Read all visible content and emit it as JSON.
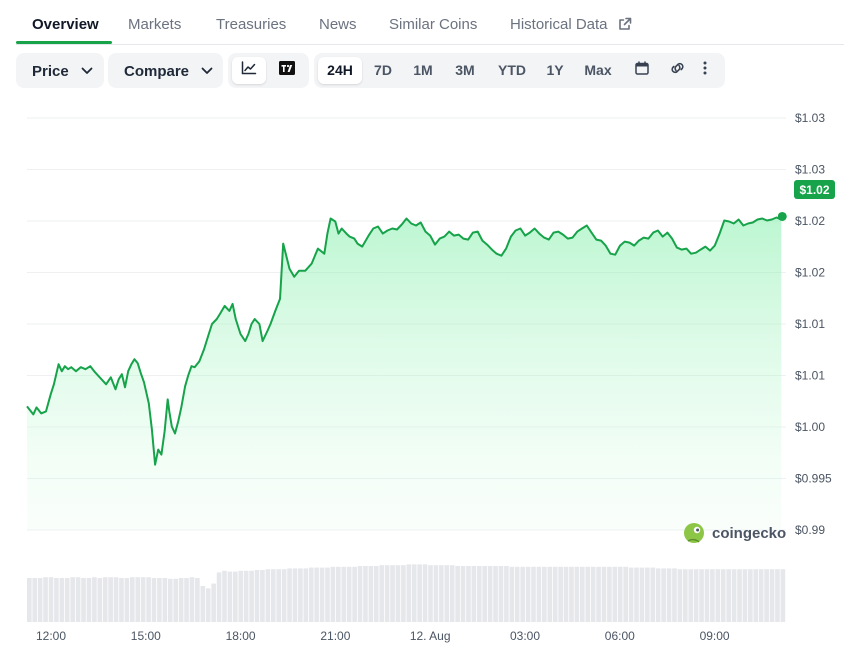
{
  "tabs": [
    {
      "label": "Overview",
      "active": true
    },
    {
      "label": "Markets"
    },
    {
      "label": "Treasuries"
    },
    {
      "label": "News"
    },
    {
      "label": "Similar Coins"
    },
    {
      "label": "Historical Data"
    }
  ],
  "toolbar": {
    "price_label": "Price",
    "compare_label": "Compare",
    "chart_view_icons": [
      "line-chart-icon",
      "tradingview-icon"
    ],
    "ranges": [
      "24H",
      "7D",
      "1M",
      "3M",
      "YTD",
      "1Y",
      "Max"
    ],
    "active_range": "24H",
    "extra_icons": [
      "calendar-icon",
      "link-icon",
      "more-icon"
    ]
  },
  "watermark": "coingecko",
  "colors": {
    "line": "#16a34a",
    "fill": "#bbf7d0",
    "volume": "#e5e7eb",
    "accent": "#16a34a"
  },
  "chart_data": {
    "type": "area",
    "y_tick_labels": [
      "$0.99",
      "$0.995",
      "$1.00",
      "$1.01",
      "$1.01",
      "$1.02",
      "$1.02",
      "$1.03",
      "$1.03"
    ],
    "ylim": [
      0.99,
      1.031
    ],
    "x_tick_labels": [
      "12:00",
      "15:00",
      "18:00",
      "21:00",
      "12. Aug",
      "03:00",
      "06:00",
      "09:00"
    ],
    "current_price_label": "$1.02",
    "series": [
      {
        "x_hours": [
          0,
          0.2,
          0.3,
          0.45,
          0.6,
          0.75,
          0.85,
          1.0,
          1.1,
          1.2,
          1.3,
          1.4,
          1.55,
          1.7,
          1.85,
          2.0,
          2.15,
          2.3,
          2.5,
          2.65,
          2.8,
          2.9,
          3.0,
          3.1,
          3.2,
          3.3,
          3.4,
          3.5,
          3.6,
          3.7,
          3.85,
          3.95,
          4.05,
          4.15,
          4.25,
          4.35,
          4.45,
          4.5,
          4.58,
          4.68,
          4.78,
          4.88,
          5.0,
          5.1,
          5.2,
          5.3,
          5.45,
          5.6,
          5.75,
          5.85,
          6.0,
          6.1,
          6.25,
          6.4,
          6.5,
          6.6,
          6.75,
          6.9,
          7.0,
          7.1,
          7.2,
          7.35,
          7.45,
          7.6,
          7.7,
          7.85,
          8.0,
          8.1,
          8.3,
          8.45,
          8.6,
          8.8,
          9.0,
          9.2,
          9.4,
          9.5,
          9.6,
          9.75,
          9.85,
          9.95,
          10.1,
          10.2,
          10.35,
          10.45,
          10.6,
          10.8,
          10.95,
          11.1,
          11.25,
          11.4,
          11.55,
          11.7,
          11.85,
          12.0,
          12.15,
          12.3,
          12.45,
          12.6,
          12.75,
          12.9,
          13.05,
          13.2,
          13.35,
          13.5,
          13.65,
          13.8,
          13.95,
          14.1,
          14.25,
          14.4,
          14.55,
          14.7,
          14.85,
          15.0,
          15.15,
          15.3,
          15.45,
          15.6,
          15.75,
          15.9,
          16.05,
          16.2,
          16.35,
          16.5,
          16.65,
          16.8,
          16.95,
          17.1,
          17.25,
          17.4,
          17.55,
          17.7,
          17.85,
          18.0,
          18.15,
          18.3,
          18.45,
          18.6,
          18.75,
          18.9,
          19.05,
          19.2,
          19.35,
          19.5,
          19.65,
          19.8,
          19.95,
          20.1,
          20.25,
          20.4,
          20.55,
          20.7,
          20.85,
          21.0,
          21.15,
          21.3,
          21.45,
          21.6,
          21.75,
          21.9,
          22.05,
          22.2,
          22.35,
          22.5,
          22.65,
          22.8,
          22.95,
          23.1,
          23.25,
          23.4,
          23.55,
          23.7,
          23.85
        ],
        "values": [
          1.0023,
          1.0015,
          1.0022,
          1.0016,
          1.0018,
          1.0035,
          1.0045,
          1.0065,
          1.0058,
          1.0063,
          1.006,
          1.0062,
          1.0058,
          1.0062,
          1.006,
          1.0063,
          1.0057,
          1.0052,
          1.0045,
          1.0052,
          1.004,
          1.005,
          1.0055,
          1.0042,
          1.0058,
          1.0065,
          1.007,
          1.0066,
          1.0056,
          1.0047,
          1.0026,
          1.0,
          0.9965,
          0.998,
          0.9975,
          0.9998,
          1.003,
          1.0018,
          1.0003,
          0.9996,
          1.0008,
          1.0022,
          1.0043,
          1.0054,
          1.0063,
          1.0062,
          1.0068,
          1.008,
          1.0095,
          1.0105,
          1.011,
          1.0115,
          1.0123,
          1.0118,
          1.0125,
          1.011,
          1.0095,
          1.0088,
          1.0095,
          1.0105,
          1.011,
          1.0105,
          1.0088,
          1.0098,
          1.0105,
          1.0118,
          1.013,
          1.0185,
          1.016,
          1.0152,
          1.0158,
          1.0158,
          1.0165,
          1.018,
          1.0175,
          1.0195,
          1.021,
          1.0207,
          1.0195,
          1.02,
          1.0195,
          1.0192,
          1.019,
          1.0185,
          1.0182,
          1.0193,
          1.02,
          1.0202,
          1.0195,
          1.0198,
          1.02,
          1.0199,
          1.0204,
          1.021,
          1.0205,
          1.0203,
          1.0206,
          1.0197,
          1.0193,
          1.0184,
          1.019,
          1.0192,
          1.0197,
          1.0193,
          1.0194,
          1.019,
          1.0189,
          1.0196,
          1.0197,
          1.0188,
          1.0184,
          1.0179,
          1.0175,
          1.0173,
          1.018,
          1.0192,
          1.0198,
          1.02,
          1.0193,
          1.0196,
          1.02,
          1.0195,
          1.0191,
          1.0189,
          1.0196,
          1.0197,
          1.0194,
          1.019,
          1.0191,
          1.0197,
          1.02,
          1.0203,
          1.0196,
          1.0189,
          1.0188,
          1.0183,
          1.0175,
          1.0174,
          1.0183,
          1.0187,
          1.0186,
          1.0183,
          1.0188,
          1.0191,
          1.019,
          1.0196,
          1.0198,
          1.0192,
          1.0196,
          1.019,
          1.0181,
          1.0179,
          1.018,
          1.0175,
          1.0176,
          1.0179,
          1.0182,
          1.0178,
          1.0183,
          1.0195,
          1.0208,
          1.0207,
          1.0205,
          1.0209,
          1.0203,
          1.0205,
          1.0206,
          1.0209,
          1.021,
          1.0208,
          1.0209,
          1.0211,
          1.0209,
          1.0212
        ]
      }
    ],
    "volume": [
      0.55,
      0.55,
      0.55,
      0.56,
      0.56,
      0.55,
      0.55,
      0.55,
      0.56,
      0.56,
      0.55,
      0.55,
      0.56,
      0.55,
      0.56,
      0.56,
      0.56,
      0.55,
      0.55,
      0.56,
      0.56,
      0.56,
      0.56,
      0.55,
      0.55,
      0.55,
      0.54,
      0.54,
      0.55,
      0.55,
      0.56,
      0.55,
      0.45,
      0.42,
      0.48,
      0.62,
      0.64,
      0.63,
      0.63,
      0.64,
      0.64,
      0.64,
      0.65,
      0.65,
      0.66,
      0.66,
      0.66,
      0.66,
      0.67,
      0.67,
      0.67,
      0.67,
      0.68,
      0.68,
      0.68,
      0.68,
      0.69,
      0.69,
      0.69,
      0.69,
      0.69,
      0.7,
      0.7,
      0.7,
      0.7,
      0.71,
      0.71,
      0.71,
      0.71,
      0.71,
      0.72,
      0.72,
      0.72,
      0.72,
      0.71,
      0.71,
      0.71,
      0.71,
      0.71,
      0.7,
      0.7,
      0.7,
      0.7,
      0.7,
      0.7,
      0.7,
      0.7,
      0.7,
      0.7,
      0.69,
      0.69,
      0.69,
      0.69,
      0.69,
      0.69,
      0.69,
      0.69,
      0.69,
      0.69,
      0.69,
      0.69,
      0.69,
      0.69,
      0.69,
      0.69,
      0.69,
      0.69,
      0.69,
      0.69,
      0.69,
      0.69,
      0.68,
      0.68,
      0.68,
      0.68,
      0.68,
      0.67,
      0.67,
      0.67,
      0.67,
      0.66,
      0.66,
      0.66,
      0.66,
      0.66,
      0.66,
      0.66,
      0.66,
      0.66,
      0.66,
      0.66,
      0.66,
      0.66,
      0.66,
      0.66,
      0.66,
      0.66,
      0.66,
      0.66,
      0.66
    ],
    "xlabel": "",
    "ylabel": "",
    "grid": true
  }
}
